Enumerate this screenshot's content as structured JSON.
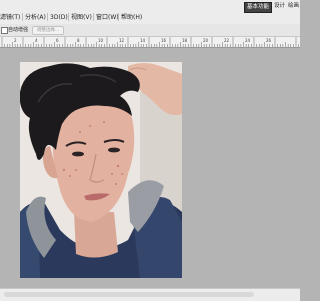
{
  "menubar": {
    "items": [
      "滤镜(T)",
      "分析(A)",
      "3D(D)",
      "视图(V)",
      "窗口(W)",
      "帮助(H)"
    ],
    "workspace": [
      "基本功能",
      "设计",
      "绘画"
    ]
  },
  "options_bar": {
    "auto_enhance_label": "自动增强",
    "refine_edge_label": "调整边缘..."
  },
  "ruler": {
    "labels": [
      "2",
      "4",
      "6",
      "8",
      "10",
      "12",
      "14",
      "16",
      "18",
      "20",
      "22",
      "24",
      "26"
    ]
  },
  "colors": {
    "canvas_bg": "#b4b4b4",
    "active_workspace": "#444444"
  }
}
